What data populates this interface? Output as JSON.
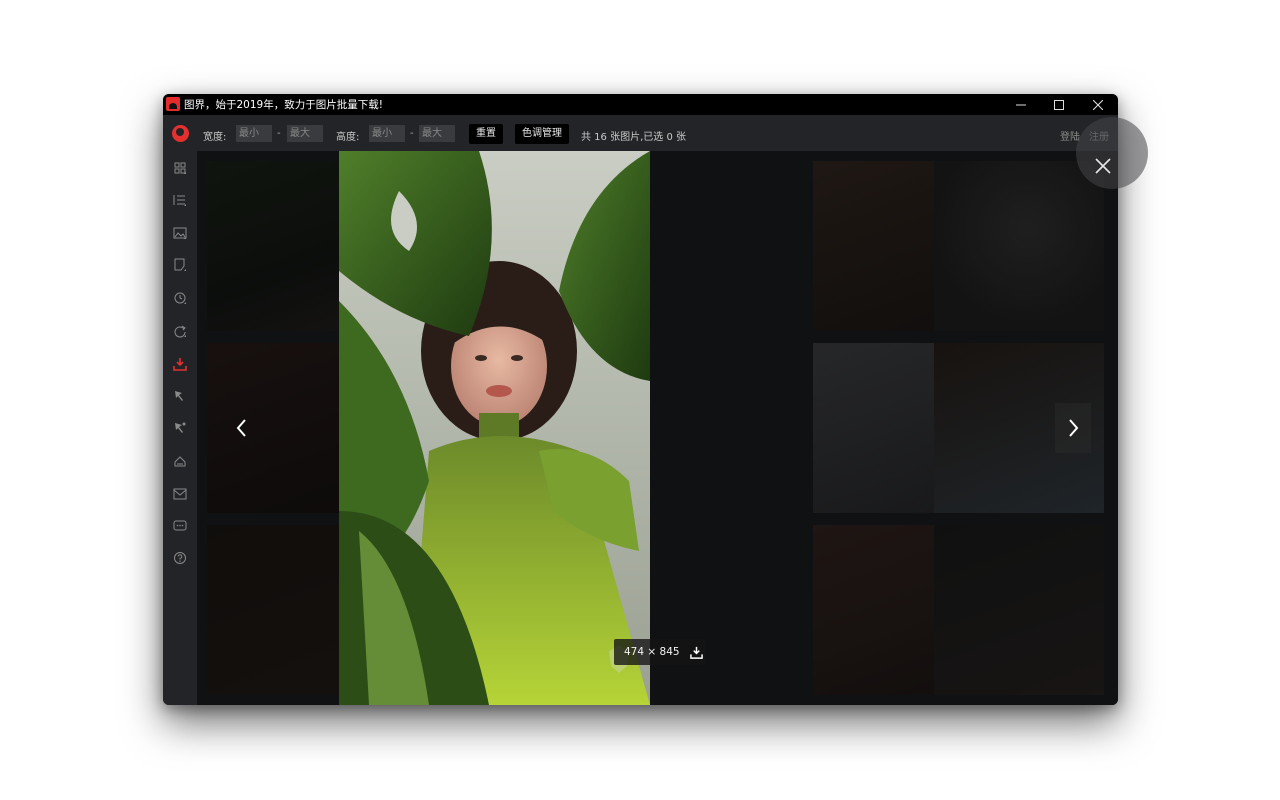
{
  "app": {
    "title": "图界，始于2019年，致力于图片批量下载!",
    "window_controls": {
      "minimize": "─",
      "maximize": "☐",
      "close": "✕"
    }
  },
  "toolbar": {
    "width_label": "宽度:",
    "width_min_placeholder": "最小",
    "width_max_placeholder": "最大",
    "height_label": "高度:",
    "height_min_placeholder": "最小",
    "height_max_placeholder": "最大",
    "dash": "-",
    "reset_button": "重置",
    "color_button": "色调管理",
    "status": "共 16 张图片,已选 0 张",
    "login": "登陆",
    "register": "注册"
  },
  "sidebar": {
    "items": [
      {
        "icon": "grid-icon"
      },
      {
        "icon": "list-icon"
      },
      {
        "icon": "image-icon"
      },
      {
        "icon": "note-icon"
      },
      {
        "icon": "history-icon"
      },
      {
        "icon": "refresh-icon"
      },
      {
        "icon": "download-icon",
        "active": true
      },
      {
        "icon": "cursor-icon"
      },
      {
        "icon": "cursor-settings-icon"
      },
      {
        "icon": "tag-icon"
      },
      {
        "icon": "mail-icon"
      },
      {
        "icon": "chat-icon"
      },
      {
        "icon": "help-icon"
      }
    ],
    "accent_color": "#e53030"
  },
  "viewer": {
    "image_size": "474 × 845",
    "close": "✕"
  },
  "colors": {
    "window_bg": "#222326",
    "titlebar_bg": "#000000",
    "accent": "#e53030"
  }
}
